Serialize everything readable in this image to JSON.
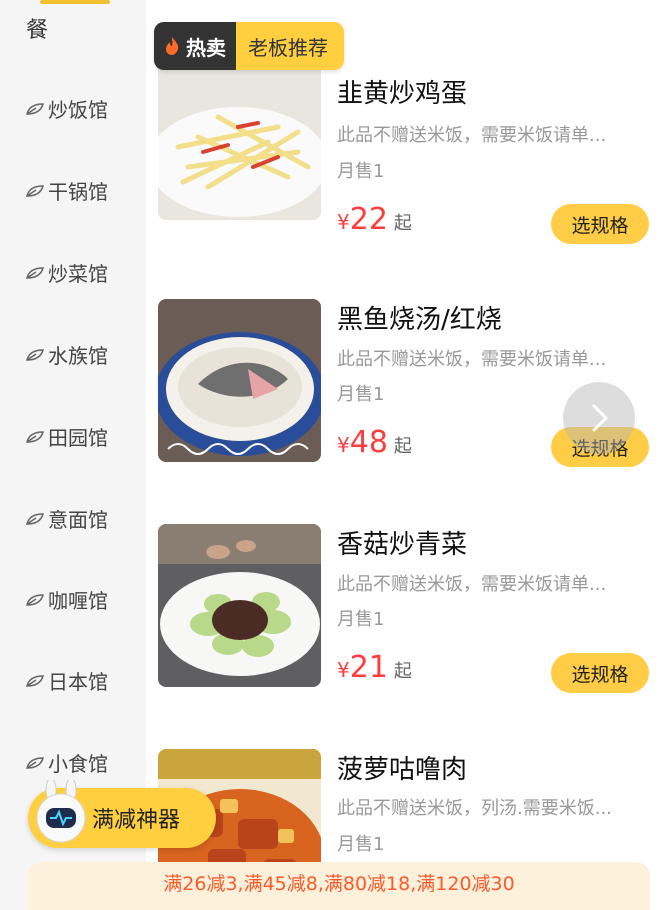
{
  "sidebar": {
    "top_label": "餐",
    "items": [
      {
        "label": "炒饭馆"
      },
      {
        "label": "干锅馆"
      },
      {
        "label": "炒菜馆"
      },
      {
        "label": "水族馆"
      },
      {
        "label": "田园馆"
      },
      {
        "label": "意面馆"
      },
      {
        "label": "咖喱馆"
      },
      {
        "label": "日本馆"
      },
      {
        "label": "小食馆"
      }
    ]
  },
  "hot_tag": {
    "hot_label": "热卖",
    "recommend_label": "老板推荐"
  },
  "products": [
    {
      "name": "韭黄炒鸡蛋",
      "desc": "此品不赠送米饭，需要米饭请单...",
      "sold": "月售1",
      "currency": "¥",
      "price": "22",
      "suffix": "起",
      "button": "选规格"
    },
    {
      "name": "黑鱼烧汤/红烧",
      "desc": "此品不赠送米饭，需要米饭请单...",
      "sold": "月售1",
      "currency": "¥",
      "price": "48",
      "suffix": "起",
      "button": "选规格"
    },
    {
      "name": "香菇炒青菜",
      "desc": "此品不赠送米饭，需要米饭请单...",
      "sold": "月售1",
      "currency": "¥",
      "price": "21",
      "suffix": "起",
      "button": "选规格"
    },
    {
      "name": "菠萝咕噜肉",
      "desc": "此品不赠送米饭，列汤.需要米饭...",
      "sold": "月售1"
    }
  ],
  "discount_tool": {
    "label": "满减神器"
  },
  "promo": {
    "text": "满26减3,满45减8,满80减18,满120减30"
  },
  "colors": {
    "accent": "#ffcd45",
    "price": "#ff3d3d",
    "promo_text": "#ff5a2a",
    "promo_bg": "#fdf1dc"
  }
}
